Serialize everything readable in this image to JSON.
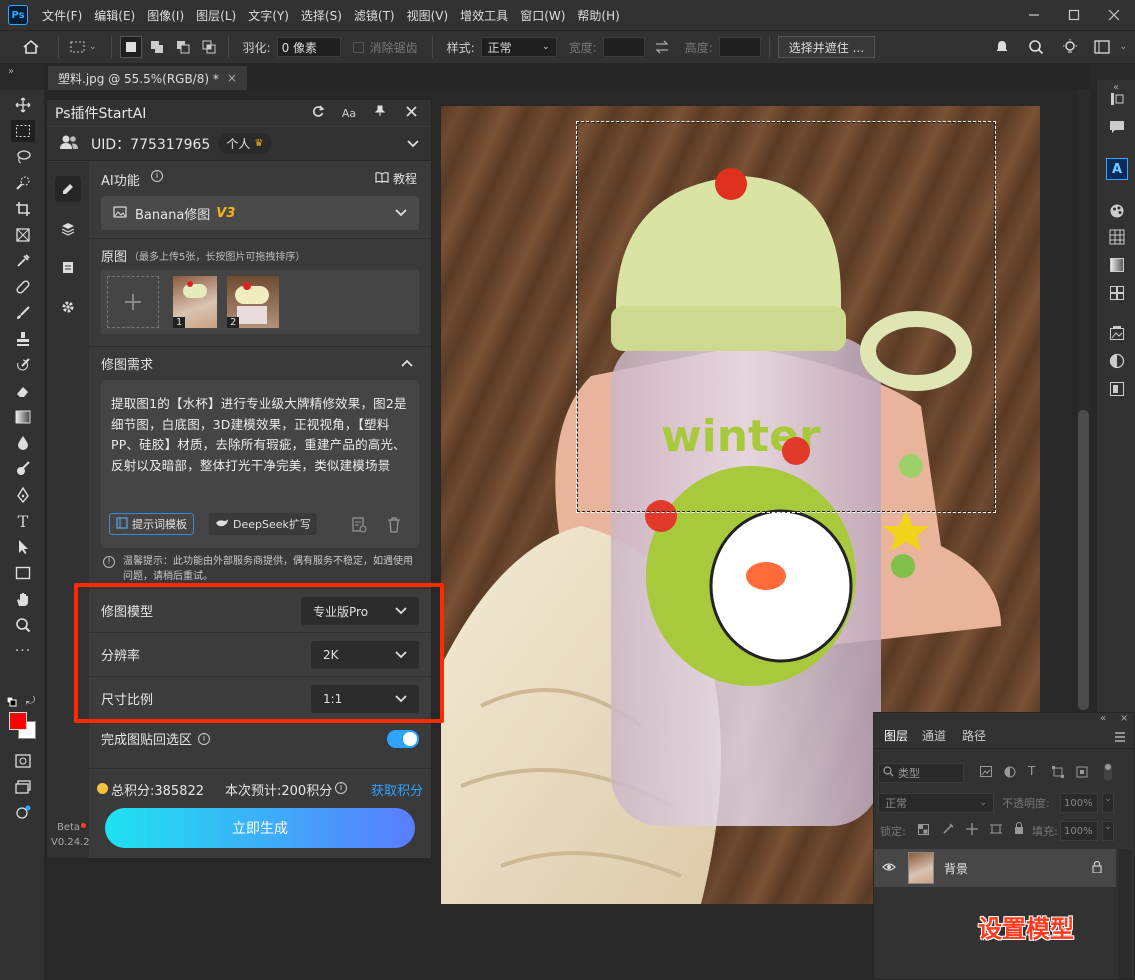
{
  "app": {
    "logo_text": "Ps",
    "menu": [
      "文件(F)",
      "编辑(E)",
      "图像(I)",
      "图层(L)",
      "文字(Y)",
      "选择(S)",
      "滤镜(T)",
      "视图(V)",
      "增效工具",
      "窗口(W)",
      "帮助(H)"
    ]
  },
  "options_bar": {
    "feather_label": "羽化:",
    "feather_value": "0 像素",
    "antialias_label": "消除锯齿",
    "style_label": "样式:",
    "style_value": "正常",
    "width_label": "宽度:",
    "height_label": "高度:",
    "select_mask_button": "选择并遮住 ..."
  },
  "document_tab": {
    "title": "塑料.jpg @ 55.5%(RGB/8) *",
    "close": "×"
  },
  "plugin": {
    "title": "Ps插件StartAI",
    "font_toggle": "Aa",
    "uid_label": "UID：775317965",
    "account_type": "个人",
    "ai_feature_label": "AI功能",
    "tutorial_label": "教程",
    "model_select": "Banana修图",
    "model_version": "V3",
    "source_label": "原图",
    "source_hint": "（最多上传5张，长按图片可拖拽排序）",
    "thumbnails": [
      {
        "index": "1"
      },
      {
        "index": "2"
      }
    ],
    "prompt_section": "修图需求",
    "prompt_text": "提取图1的【水杯】进行专业级大牌精修效果，图2是细节图，白底图，3D建模效果，正视视角，【塑料PP、硅胶】材质，去除所有瑕疵，重建产品的高光、反射以及暗部，整体打光干净完美，类似建模场景",
    "template_button": "提示词模板",
    "deepseek_button": "DeepSeek扩写",
    "notice": "温馨提示：此功能由外部服务商提供，偶有服务不稳定，如遇使用问题，请稍后重试。",
    "settings": [
      {
        "label": "修图模型",
        "value": "专业版Pro"
      },
      {
        "label": "分辨率",
        "value": "2K"
      },
      {
        "label": "尺寸比例",
        "value": "1:1"
      }
    ],
    "paste_back_label": "完成图贴回选区",
    "paste_back_on": true,
    "points_total": "总积分:385822",
    "points_estimate": "本次预计:200积分",
    "get_points": "获取积分",
    "generate_button": "立即生成",
    "beta_label": "Beta",
    "version": "V0.24.2"
  },
  "layers_panel": {
    "tabs": [
      "图层",
      "通道",
      "路径"
    ],
    "filter_placeholder": "类型",
    "blend_mode": "正常",
    "opacity_label": "不透明度:",
    "opacity_value": "100%",
    "lock_label": "锁定:",
    "fill_label": "填充:",
    "fill_value": "100%",
    "layer_name": "背景"
  },
  "annotation": {
    "text": "设置模型",
    "color": "#ff3b1f"
  },
  "colors": {
    "foreground": "#ff0000",
    "background": "#ffffff",
    "highlight": "#ff2a00",
    "accent": "#31a8ff",
    "generate_gradient_start": "#1ee3f0",
    "generate_gradient_end": "#5a7cff"
  }
}
